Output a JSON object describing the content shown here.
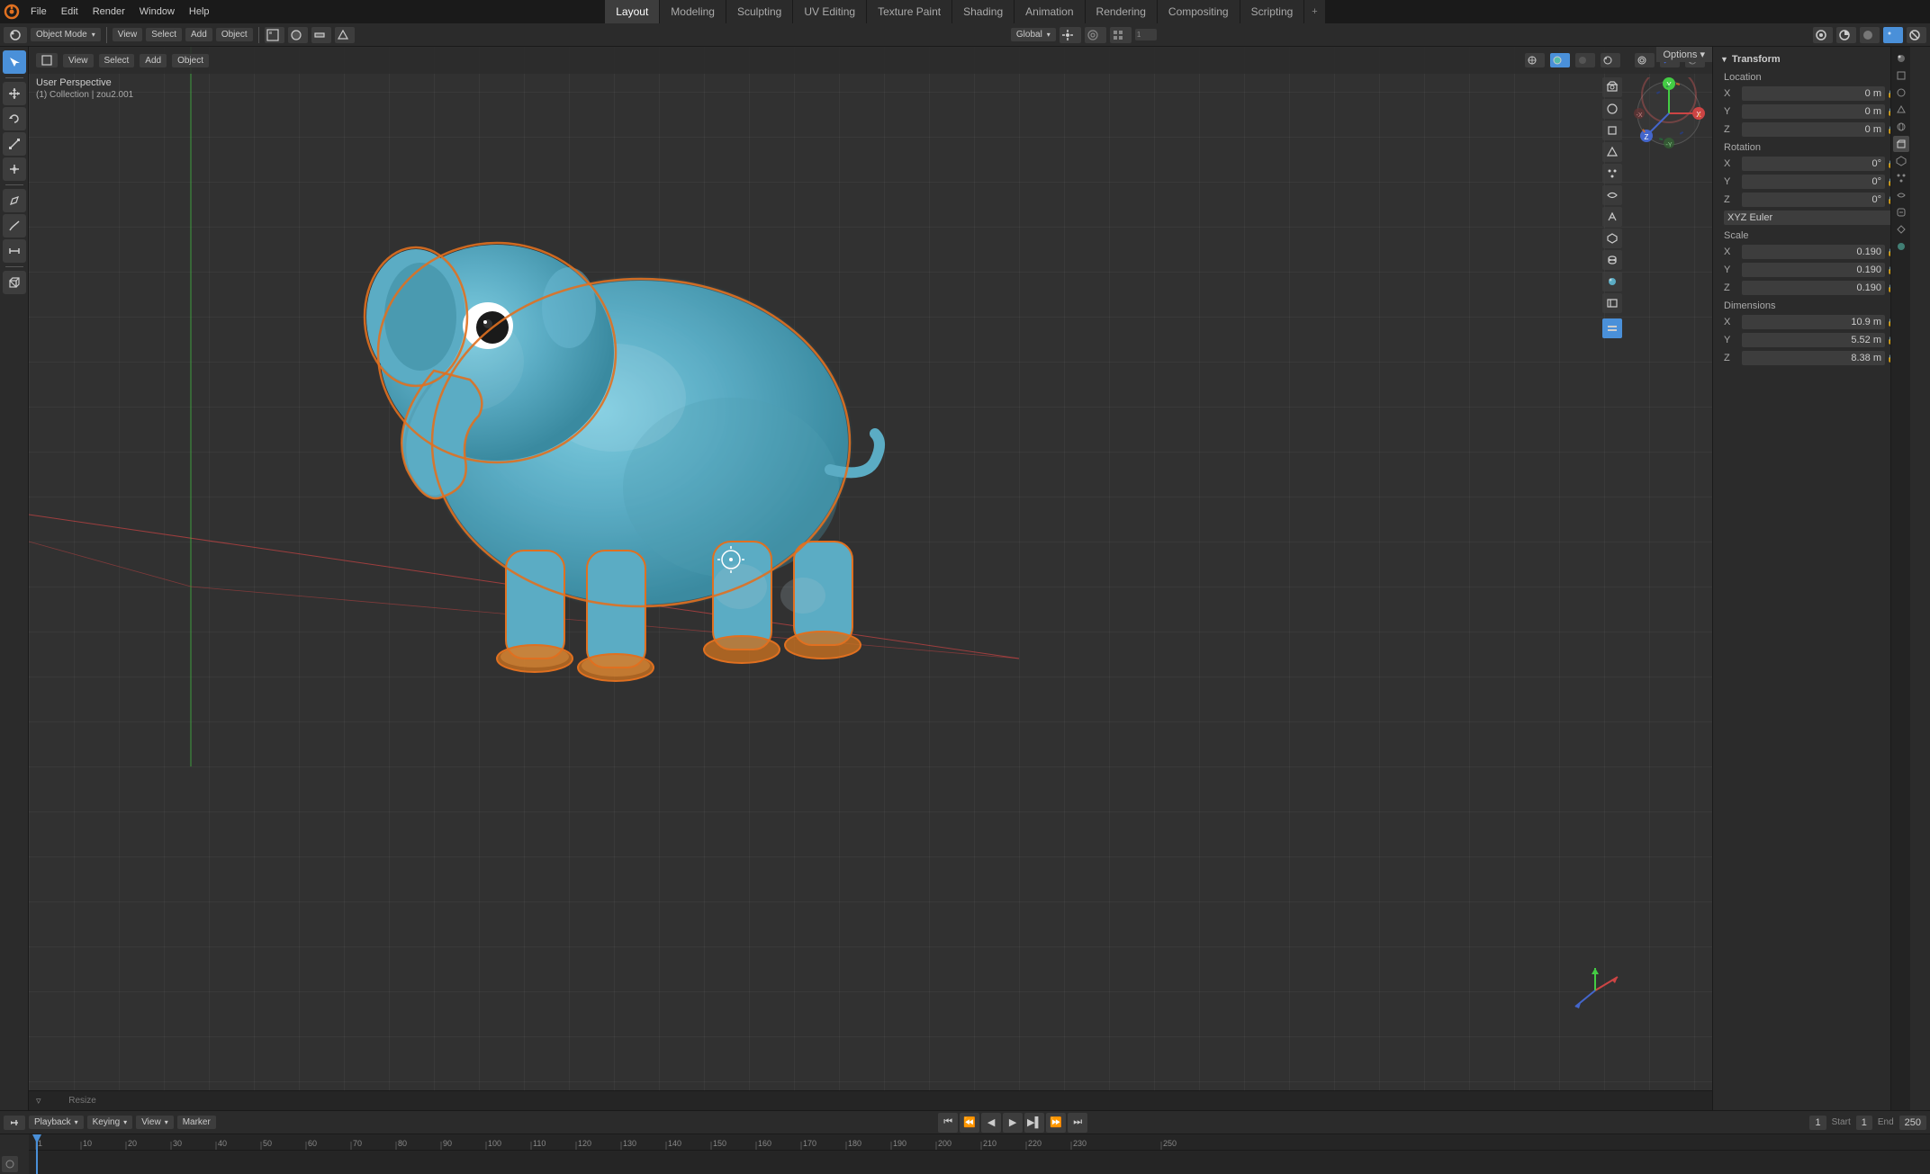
{
  "app": {
    "title": "Blender"
  },
  "top_menu": {
    "items": [
      "File",
      "Edit",
      "Render",
      "Window",
      "Help"
    ]
  },
  "workspace_tabs": [
    {
      "label": "Layout",
      "active": true
    },
    {
      "label": "Modeling",
      "active": false
    },
    {
      "label": "Sculpting",
      "active": false
    },
    {
      "label": "UV Editing",
      "active": false
    },
    {
      "label": "Texture Paint",
      "active": false
    },
    {
      "label": "Shading",
      "active": false
    },
    {
      "label": "Animation",
      "active": false
    },
    {
      "label": "Rendering",
      "active": false
    },
    {
      "label": "Compositing",
      "active": false
    },
    {
      "label": "Scripting",
      "active": false
    }
  ],
  "header": {
    "mode_label": "Object Mode",
    "view_label": "View",
    "select_label": "Select",
    "add_label": "Add",
    "object_label": "Object",
    "global_label": "Global",
    "options_label": "Options ▾"
  },
  "viewport": {
    "info": {
      "perspective": "User Perspective",
      "collection": "(1) Collection | zou2.001"
    },
    "object_name": "zou2"
  },
  "transform": {
    "title": "Transform",
    "location": {
      "label": "Location",
      "x_label": "X",
      "x_value": "0 m",
      "y_label": "Y",
      "y_value": "0 m",
      "z_label": "Z",
      "z_value": "0 m"
    },
    "rotation": {
      "label": "Rotation",
      "x_label": "X",
      "x_value": "0°",
      "y_label": "Y",
      "y_value": "0°",
      "z_label": "Z",
      "z_value": "0°",
      "mode": "XYZ Euler"
    },
    "scale": {
      "label": "Scale",
      "x_label": "X",
      "x_value": "0.190",
      "y_label": "Y",
      "y_value": "0.190",
      "z_label": "Z",
      "z_value": "0.190"
    },
    "dimensions": {
      "label": "Dimensions",
      "x_label": "X",
      "x_value": "10.9 m",
      "y_label": "Y",
      "y_value": "5.52 m",
      "z_label": "Z",
      "z_value": "8.38 m"
    }
  },
  "timeline": {
    "playback_label": "Playback",
    "keying_label": "Keying",
    "view_label": "View",
    "marker_label": "Marker",
    "start_label": "Start",
    "start_value": "1",
    "end_label": "End",
    "end_value": "250",
    "current_frame": "1",
    "frame_display": "1",
    "ticks": [
      "1",
      "10",
      "20",
      "30",
      "40",
      "50",
      "60",
      "70",
      "80",
      "90",
      "100",
      "110",
      "120",
      "130",
      "140",
      "150",
      "160",
      "170",
      "180",
      "190",
      "200",
      "210",
      "220",
      "230",
      "250"
    ]
  },
  "left_tools": [
    {
      "icon": "↖",
      "name": "select-tool",
      "active": true
    },
    {
      "icon": "⊕",
      "name": "move-tool",
      "active": false
    },
    {
      "icon": "↺",
      "name": "rotate-tool",
      "active": false
    },
    {
      "icon": "⊞",
      "name": "scale-tool",
      "active": false
    },
    {
      "icon": "⊙",
      "name": "transform-tool",
      "active": false
    },
    {
      "separator": true
    },
    {
      "icon": "⊡",
      "name": "annotate-tool",
      "active": false
    },
    {
      "icon": "✎",
      "name": "draw-tool",
      "active": false
    },
    {
      "icon": "◈",
      "name": "measure-tool",
      "active": false
    },
    {
      "separator": true
    },
    {
      "icon": "⊞",
      "name": "add-tool",
      "active": false
    }
  ],
  "colors": {
    "accent_blue": "#4a90d9",
    "bg_dark": "#1a1a1a",
    "bg_medium": "#2b2b2b",
    "bg_light": "#3d3d3d",
    "elephant_blue": "#5bacc4",
    "selection_orange": "#e07020",
    "grid_line": "rgba(255,255,255,0.06)",
    "axis_x": "#cc4444",
    "axis_y": "#44cc44",
    "axis_z": "#4466cc"
  }
}
